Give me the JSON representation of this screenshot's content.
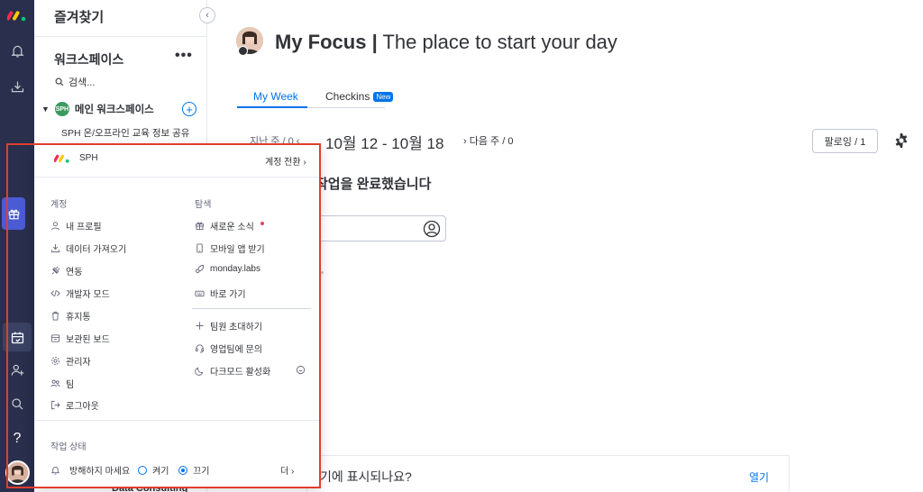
{
  "colors": {
    "rail": "#292f4c",
    "accent": "#0073ea",
    "highlight_frame": "#e03e2d"
  },
  "sidebar": {
    "title": "즐겨찾기",
    "workspace_title": "워크스페이스",
    "more": "•••",
    "search": "검색...",
    "main_workspace": "메인 워크스페이스",
    "main_workspace_badge": "SPH",
    "sub_item": "SPH 온/오프라인 교육 정보 공유",
    "bottom_item": "Data Consulting"
  },
  "main": {
    "title_bold": "My Focus |",
    "title_rest": " The place to start your day",
    "tabs": [
      {
        "label": "My Week"
      },
      {
        "label": "Checkins",
        "badge": "New"
      }
    ],
    "prev_week": "지난 주 / 0",
    "week_range": "10월 12 - 10월 18",
    "next_week": "다음 주 / 0",
    "follow_button": "팔로잉 / 1",
    "completed_text": "작업을 완료했습니다",
    "bottom_question": "기에 표시되나요?",
    "bottom_open": "열기"
  },
  "popup": {
    "brand": "SPH",
    "switch_account": "계정 전환",
    "account_header": "계정",
    "account_items": [
      "내 프로필",
      "데이터 가져오기",
      "연동",
      "개발자 모드",
      "휴지통",
      "보관된 보드",
      "관리자",
      "팀",
      "로그아웃"
    ],
    "explore_header": "탐색",
    "explore_items": [
      "새로운 소식",
      "모바일 앱 받기",
      "monday.labs",
      "바로 가기"
    ],
    "extra_items": [
      "팀원 초대하기",
      "영업팀에 문의",
      "다크모드 활성화"
    ],
    "status_header": "작업 상태",
    "dnd_label": "방해하지 마세요",
    "on_label": "켜기",
    "off_label": "끄기",
    "more": "더"
  }
}
